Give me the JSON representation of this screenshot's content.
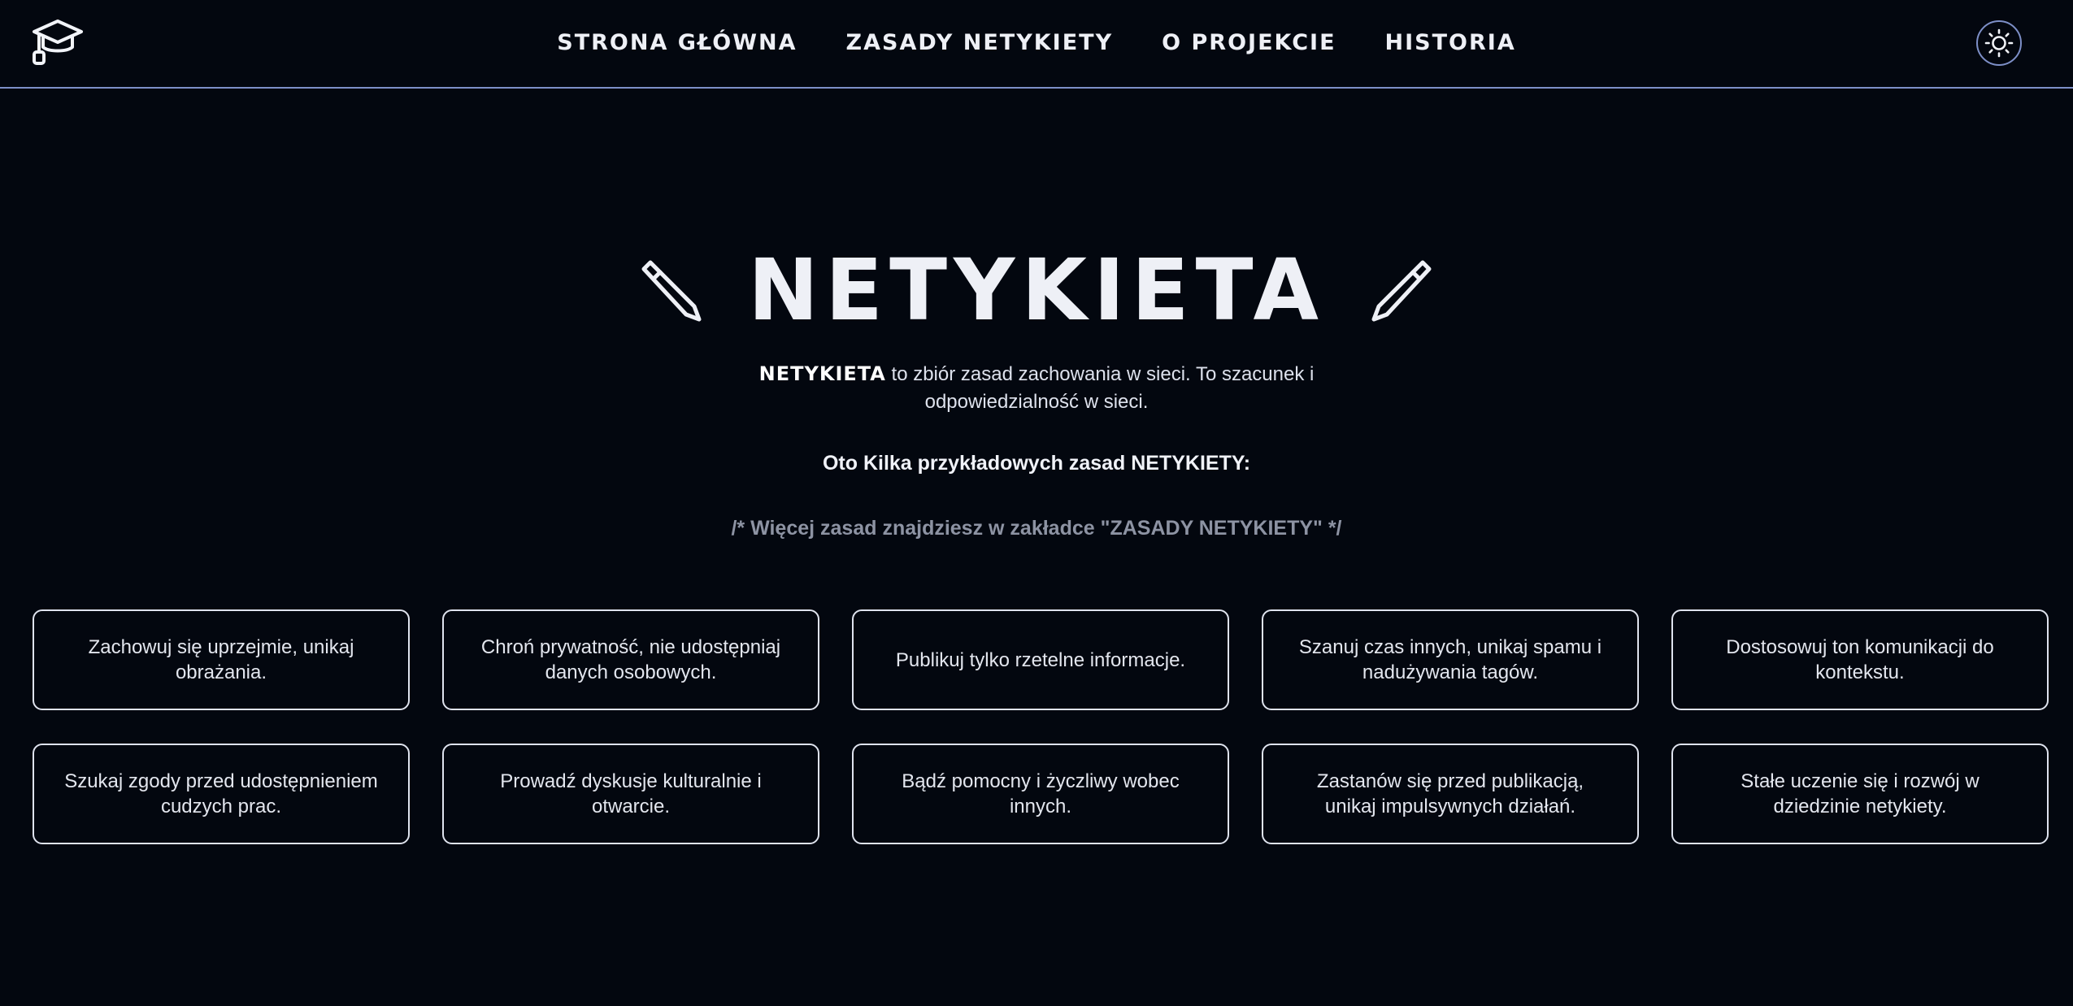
{
  "header": {
    "nav": [
      {
        "label": "STRONA GŁÓWNA"
      },
      {
        "label": "ZASADY NETYKIETY"
      },
      {
        "label": "O PROJEKCIE"
      },
      {
        "label": "HISTORIA"
      }
    ],
    "logo_icon": "graduation-cap-icon",
    "theme_icon": "sun-icon"
  },
  "hero": {
    "title": "NETYKIETA",
    "intro_strong": "NETYKIETA",
    "intro_rest": " to zbiór zasad zachowania w sieci. To szacunek i odpowiedzialność w sieci.",
    "examples_heading": "Oto Kilka przykładowych zasad NETYKIETY:",
    "more_note": "/* Więcej zasad znajdziesz w zakładce \"ZASADY NETYKIETY\" */"
  },
  "rules": [
    {
      "text": "Zachowuj się uprzejmie, unikaj obrażania."
    },
    {
      "text": "Chroń prywatność, nie udostępniaj danych osobowych."
    },
    {
      "text": "Publikuj tylko rzetelne informacje."
    },
    {
      "text": "Szanuj czas innych, unikaj spamu i nadużywania tagów."
    },
    {
      "text": "Dostosowuj ton komunikacji do kontekstu."
    },
    {
      "text": "Szukaj zgody przed udostępnieniem cudzych prac."
    },
    {
      "text": "Prowadź dyskusje kulturalnie i otwarcie."
    },
    {
      "text": "Bądź pomocny i życzliwy wobec innych."
    },
    {
      "text": "Zastanów się przed publikacją, unikaj impulsywnych działań."
    },
    {
      "text": "Stałe uczenie się i rozwój w dziedzinie netykiety."
    }
  ],
  "colors": {
    "background": "#03070f",
    "accent_border": "#7d8fc7",
    "text": "#eef0f6",
    "muted": "#8d93a3"
  }
}
